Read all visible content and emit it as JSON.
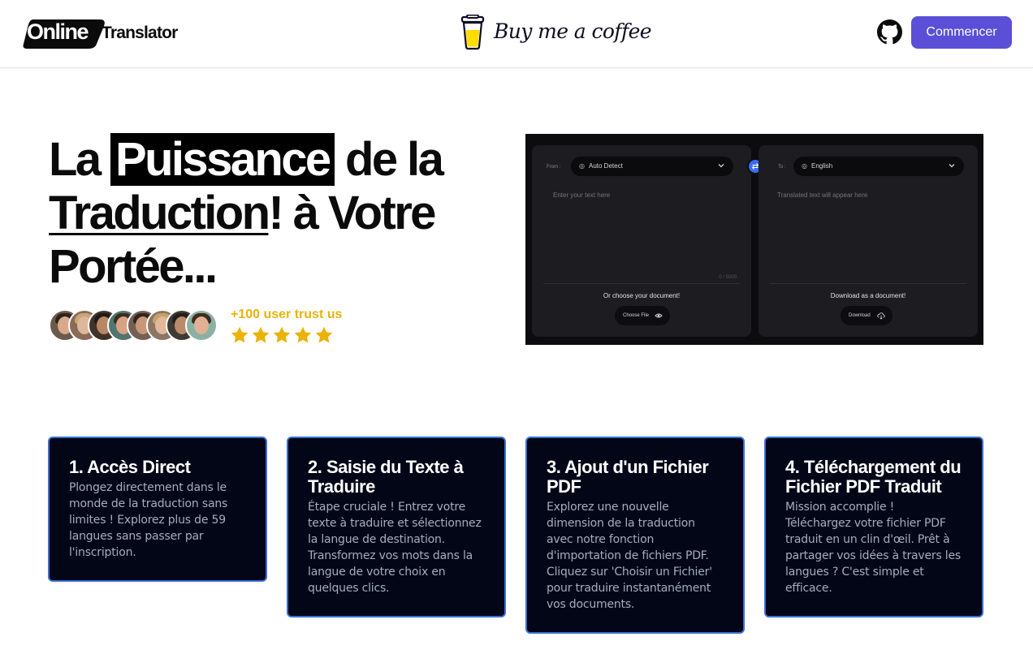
{
  "header": {
    "logo_online": "Online",
    "logo_translator": "Translator",
    "bmc_text": "Buy me a coffee",
    "start_label": "Commencer"
  },
  "hero": {
    "title_part1": "La ",
    "title_highlight": "Puissance",
    "title_part2": " de la",
    "title_underline": "Traduction",
    "title_part3": "! à Votre",
    "title_part4": "Portée...",
    "trust_text": "+100 user trust us",
    "rating": 5,
    "accent_color": "#e8b30c"
  },
  "mockup": {
    "from_label": "From :",
    "from_lang": "Auto Detect",
    "to_label": "To :",
    "to_lang": "English",
    "input_placeholder": "Enter your text here",
    "output_placeholder": "Translated text will appear here",
    "char_count": "0 / 5000",
    "choose_doc_text": "Or choose your document!",
    "choose_file_label": "Choose File",
    "download_doc_text": "Download as a document!",
    "download_label": "Download"
  },
  "cards": [
    {
      "title": "1. Accès Direct",
      "text": "Plongez directement dans le monde de la traduction sans limites ! Explorez plus de 59 langues sans passer par l'inscription."
    },
    {
      "title": "2. Saisie du Texte à Traduire",
      "text": "Étape cruciale ! Entrez votre texte à traduire et sélectionnez la langue de destination. Transformez vos mots dans la langue de votre choix en quelques clics."
    },
    {
      "title": "3. Ajout d'un Fichier PDF",
      "text": "Explorez une nouvelle dimension de la traduction avec notre fonction d'importation de fichiers PDF. Cliquez sur 'Choisir un Fichier' pour traduire instantanément vos documents."
    },
    {
      "title": "4. Téléchargement du Fichier PDF Traduit",
      "text": "Mission accomplie ! Téléchargez votre fichier PDF traduit en un clin d'œil. Prêt à partager vos idées à travers les langues ? C'est simple et efficace."
    }
  ],
  "colors": {
    "primary_button": "#5b4fd8",
    "card_background": "#020617",
    "card_border": "#3b6fd4"
  }
}
